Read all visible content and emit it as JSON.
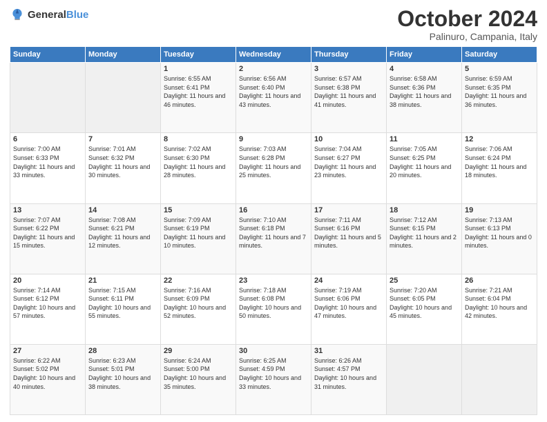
{
  "logo": {
    "general": "General",
    "blue": "Blue"
  },
  "title": {
    "month_year": "October 2024",
    "location": "Palinuro, Campania, Italy"
  },
  "header_days": [
    "Sunday",
    "Monday",
    "Tuesday",
    "Wednesday",
    "Thursday",
    "Friday",
    "Saturday"
  ],
  "weeks": [
    [
      {
        "day": "",
        "empty": true
      },
      {
        "day": "",
        "empty": true
      },
      {
        "day": "1",
        "sunrise": "6:55 AM",
        "sunset": "6:41 PM",
        "daylight": "11 hours and 46 minutes."
      },
      {
        "day": "2",
        "sunrise": "6:56 AM",
        "sunset": "6:40 PM",
        "daylight": "11 hours and 43 minutes."
      },
      {
        "day": "3",
        "sunrise": "6:57 AM",
        "sunset": "6:38 PM",
        "daylight": "11 hours and 41 minutes."
      },
      {
        "day": "4",
        "sunrise": "6:58 AM",
        "sunset": "6:36 PM",
        "daylight": "11 hours and 38 minutes."
      },
      {
        "day": "5",
        "sunrise": "6:59 AM",
        "sunset": "6:35 PM",
        "daylight": "11 hours and 36 minutes."
      }
    ],
    [
      {
        "day": "6",
        "sunrise": "7:00 AM",
        "sunset": "6:33 PM",
        "daylight": "11 hours and 33 minutes."
      },
      {
        "day": "7",
        "sunrise": "7:01 AM",
        "sunset": "6:32 PM",
        "daylight": "11 hours and 30 minutes."
      },
      {
        "day": "8",
        "sunrise": "7:02 AM",
        "sunset": "6:30 PM",
        "daylight": "11 hours and 28 minutes."
      },
      {
        "day": "9",
        "sunrise": "7:03 AM",
        "sunset": "6:28 PM",
        "daylight": "11 hours and 25 minutes."
      },
      {
        "day": "10",
        "sunrise": "7:04 AM",
        "sunset": "6:27 PM",
        "daylight": "11 hours and 23 minutes."
      },
      {
        "day": "11",
        "sunrise": "7:05 AM",
        "sunset": "6:25 PM",
        "daylight": "11 hours and 20 minutes."
      },
      {
        "day": "12",
        "sunrise": "7:06 AM",
        "sunset": "6:24 PM",
        "daylight": "11 hours and 18 minutes."
      }
    ],
    [
      {
        "day": "13",
        "sunrise": "7:07 AM",
        "sunset": "6:22 PM",
        "daylight": "11 hours and 15 minutes."
      },
      {
        "day": "14",
        "sunrise": "7:08 AM",
        "sunset": "6:21 PM",
        "daylight": "11 hours and 12 minutes."
      },
      {
        "day": "15",
        "sunrise": "7:09 AM",
        "sunset": "6:19 PM",
        "daylight": "11 hours and 10 minutes."
      },
      {
        "day": "16",
        "sunrise": "7:10 AM",
        "sunset": "6:18 PM",
        "daylight": "11 hours and 7 minutes."
      },
      {
        "day": "17",
        "sunrise": "7:11 AM",
        "sunset": "6:16 PM",
        "daylight": "11 hours and 5 minutes."
      },
      {
        "day": "18",
        "sunrise": "7:12 AM",
        "sunset": "6:15 PM",
        "daylight": "11 hours and 2 minutes."
      },
      {
        "day": "19",
        "sunrise": "7:13 AM",
        "sunset": "6:13 PM",
        "daylight": "11 hours and 0 minutes."
      }
    ],
    [
      {
        "day": "20",
        "sunrise": "7:14 AM",
        "sunset": "6:12 PM",
        "daylight": "10 hours and 57 minutes."
      },
      {
        "day": "21",
        "sunrise": "7:15 AM",
        "sunset": "6:11 PM",
        "daylight": "10 hours and 55 minutes."
      },
      {
        "day": "22",
        "sunrise": "7:16 AM",
        "sunset": "6:09 PM",
        "daylight": "10 hours and 52 minutes."
      },
      {
        "day": "23",
        "sunrise": "7:18 AM",
        "sunset": "6:08 PM",
        "daylight": "10 hours and 50 minutes."
      },
      {
        "day": "24",
        "sunrise": "7:19 AM",
        "sunset": "6:06 PM",
        "daylight": "10 hours and 47 minutes."
      },
      {
        "day": "25",
        "sunrise": "7:20 AM",
        "sunset": "6:05 PM",
        "daylight": "10 hours and 45 minutes."
      },
      {
        "day": "26",
        "sunrise": "7:21 AM",
        "sunset": "6:04 PM",
        "daylight": "10 hours and 42 minutes."
      }
    ],
    [
      {
        "day": "27",
        "sunrise": "6:22 AM",
        "sunset": "5:02 PM",
        "daylight": "10 hours and 40 minutes."
      },
      {
        "day": "28",
        "sunrise": "6:23 AM",
        "sunset": "5:01 PM",
        "daylight": "10 hours and 38 minutes."
      },
      {
        "day": "29",
        "sunrise": "6:24 AM",
        "sunset": "5:00 PM",
        "daylight": "10 hours and 35 minutes."
      },
      {
        "day": "30",
        "sunrise": "6:25 AM",
        "sunset": "4:59 PM",
        "daylight": "10 hours and 33 minutes."
      },
      {
        "day": "31",
        "sunrise": "6:26 AM",
        "sunset": "4:57 PM",
        "daylight": "10 hours and 31 minutes."
      },
      {
        "day": "",
        "empty": true
      },
      {
        "day": "",
        "empty": true
      }
    ]
  ],
  "labels": {
    "sunrise": "Sunrise: ",
    "sunset": "Sunset: ",
    "daylight": "Daylight: "
  }
}
